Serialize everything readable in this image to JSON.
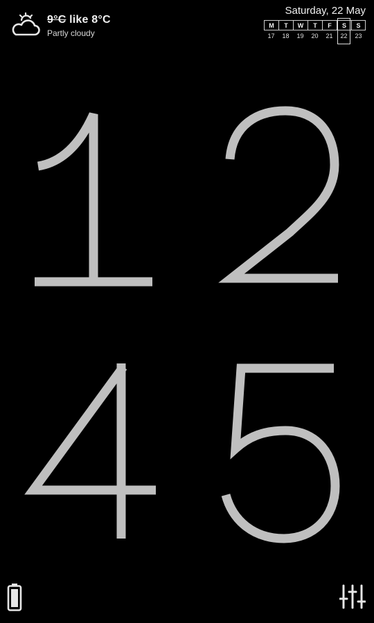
{
  "weather": {
    "icon": "partly-cloudy-icon",
    "temp_actual": "9°C",
    "like_text": "like 8°C",
    "condition": "Partly cloudy"
  },
  "date": {
    "title": "Saturday, 22 May",
    "week": [
      {
        "day": "M",
        "num": "17",
        "today": false
      },
      {
        "day": "T",
        "num": "18",
        "today": false
      },
      {
        "day": "W",
        "num": "19",
        "today": false
      },
      {
        "day": "T",
        "num": "20",
        "today": false
      },
      {
        "day": "F",
        "num": "21",
        "today": false
      },
      {
        "day": "S",
        "num": "22",
        "today": true
      },
      {
        "day": "S",
        "num": "23",
        "today": false
      }
    ]
  },
  "clock": {
    "hour_tens": "1",
    "hour_ones": "2",
    "minute_tens": "4",
    "minute_ones": "5",
    "digit_color": "#bfbfbf"
  },
  "footer": {
    "battery_icon": "battery-icon",
    "settings_icon": "equalizer-sliders-icon"
  }
}
